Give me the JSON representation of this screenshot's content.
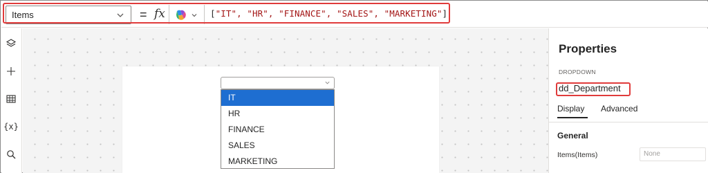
{
  "formula_bar": {
    "property_value": "Items",
    "equals": "=",
    "fx_label": "fx",
    "formula_prefix": "[",
    "formula_strings": "\"IT\", \"HR\", \"FINANCE\", \"SALES\", \"MARKETING\"",
    "formula_suffix": "]",
    "formula_color": "#a31515",
    "highlight_color": "#e03b3b"
  },
  "left_rail": {
    "icons": [
      "layers-icon",
      "plus-icon",
      "table-icon",
      "variables-icon",
      "search-icon"
    ],
    "variables_glyph": "{x}"
  },
  "canvas": {
    "dropdown": {
      "selected_value": "",
      "options": [
        "IT",
        "HR",
        "FINANCE",
        "SALES",
        "MARKETING"
      ],
      "highlighted_option": "IT",
      "highlight_color": "#1e6ed1"
    }
  },
  "properties": {
    "title": "Properties",
    "control_type": "DROPDOWN",
    "control_name": "dd_Department",
    "tabs": [
      "Display",
      "Advanced"
    ],
    "active_tab": "Display",
    "section_title": "General",
    "items_label": "Items(Items)",
    "items_placeholder": "None"
  }
}
